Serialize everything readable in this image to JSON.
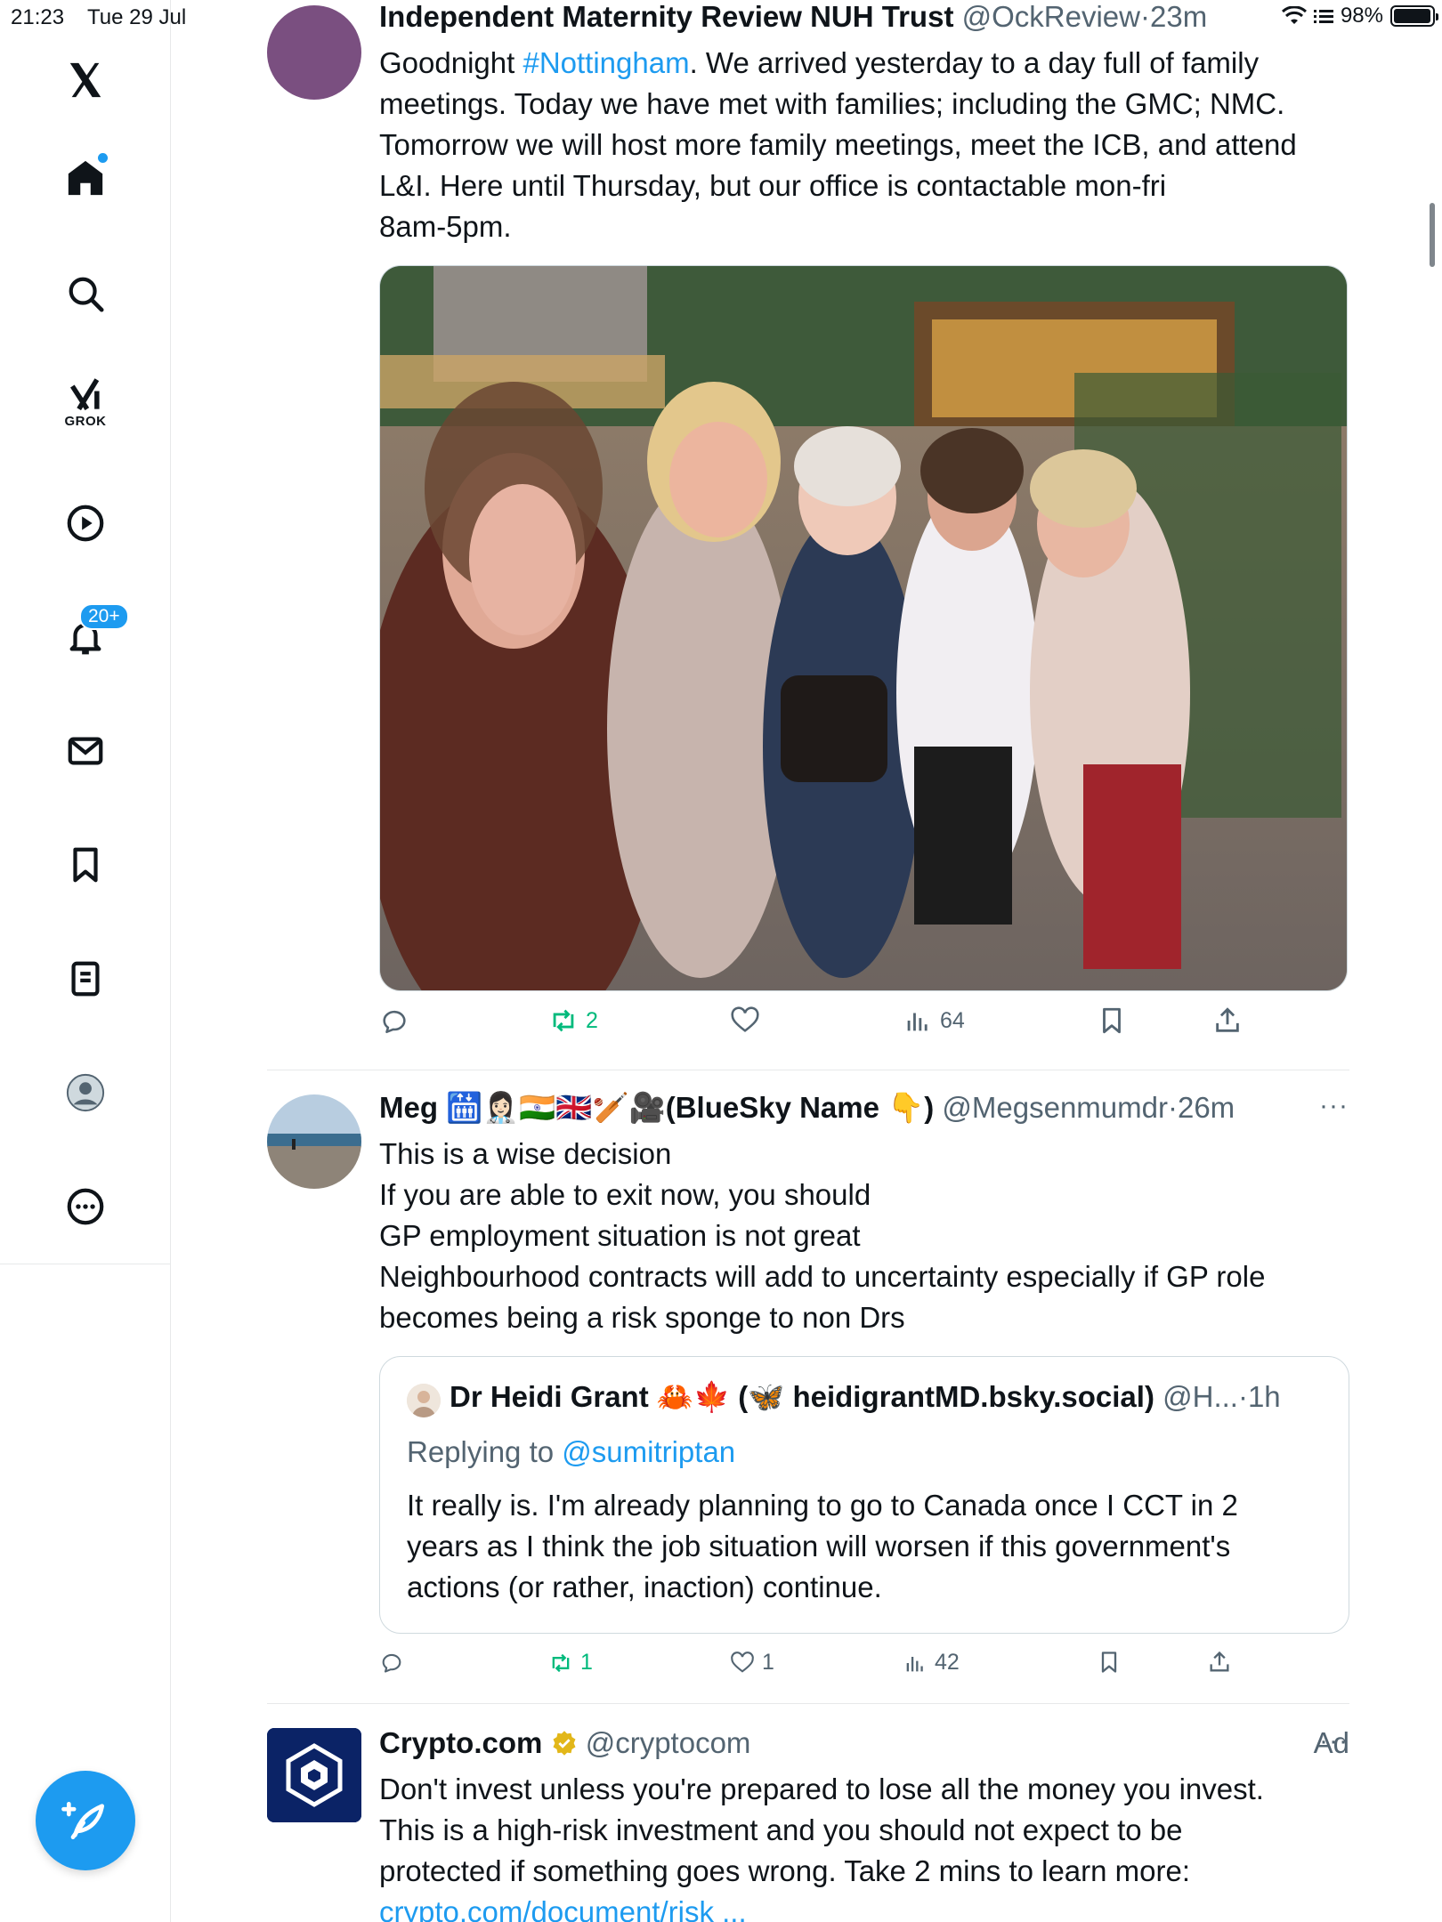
{
  "status_bar": {
    "time": "21:23",
    "date": "Tue 29 Jul",
    "battery": "98%",
    "battery_level": 0.98
  },
  "sidebar": {
    "grok_label": "GROK",
    "notifications_badge": "20+"
  },
  "tweets": [
    {
      "name": "Independent Maternity Review NUH Trust",
      "handle": "@OckReview",
      "sep": "·",
      "time": "23m",
      "body_pre": "Goodnight ",
      "hashtag": "#Nottingham",
      "body_post": ". We arrived yesterday to a day full of family",
      "lines": [
        "meetings. Today we have met with families; including the GMC; NMC.",
        "Tomorrow we will host more family meetings, meet the ICB, and attend",
        "L&I. Here until Thursday, but our office is contactable mon-fri",
        "8am-5pm."
      ],
      "actions": {
        "replies": "",
        "retweets": "2",
        "likes": "",
        "views": "64"
      }
    },
    {
      "name": "Meg 🛗👩🏻‍⚕️🇮🇳🇬🇧🏏🎥(BlueSky Name 👇)",
      "handle": "@Megsenmumdr",
      "sep": "·",
      "time": "26m",
      "more": "···",
      "lines": [
        "This is a wise decision",
        "If you are able to exit now, you should",
        "GP employment situation is not great",
        "Neighbourhood contracts will add to uncertainty especially if GP role",
        "becomes being a risk sponge to non Drs"
      ],
      "quote": {
        "name": "Dr Heidi Grant 🦀🍁 (🦋 heidigrantMD.bsky.social)",
        "handle": "@H...",
        "sep": "·",
        "time": "1h",
        "replying_prefix": "Replying to ",
        "replying_to": "@sumitriptan",
        "lines": [
          "It really is. I'm already planning to go to Canada once I CCT in 2",
          "years as I think the job situation will worsen if this government's",
          "actions (or rather, inaction) continue."
        ]
      },
      "actions": {
        "replies": "",
        "retweets": "1",
        "likes": "1",
        "views": "42"
      }
    },
    {
      "name": "Crypto.com",
      "handle": "@cryptocom",
      "ad": "Ad",
      "more": "···",
      "lines": [
        "Don't invest unless you're prepared to lose all the money you invest.",
        "This is a high-risk investment and you should not expect to be",
        "protected if something goes wrong. Take 2 mins to learn more:"
      ],
      "link": "crypto.com/document/risk ..."
    }
  ],
  "colors": {
    "accent": "#1d9bf0",
    "retweet_green": "#00ba7c",
    "secondary_text": "#536471"
  }
}
